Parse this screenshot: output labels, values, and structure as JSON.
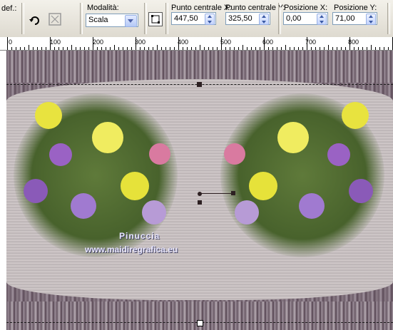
{
  "toolbar": {
    "partial_label": "def.:",
    "mode_label": "Modalità:",
    "mode_value": "Scala",
    "center_x_label": "Punto centrale X:",
    "center_x_value": "447,50",
    "center_y_label": "Punto centrale Y:",
    "center_y_value": "325,50",
    "pos_x_label": "Posizione X:",
    "pos_x_value": "0,00",
    "pos_y_label": "Posizione Y:",
    "pos_y_value": "71,00"
  },
  "ruler": {
    "labels": [
      "0",
      "100",
      "200",
      "300",
      "400",
      "500",
      "600",
      "700",
      "800"
    ]
  },
  "canvas": {
    "watermark_line1": "Pinuccia",
    "watermark_line2": "www.maidiregrafica.eu"
  },
  "colors": {
    "canvas_base": "#7a6874",
    "wave": "#c9c2c2",
    "field_border": "#7f9db9",
    "flower_yellow": "#e6e23a",
    "flower_purple": "#8a5ab8"
  }
}
